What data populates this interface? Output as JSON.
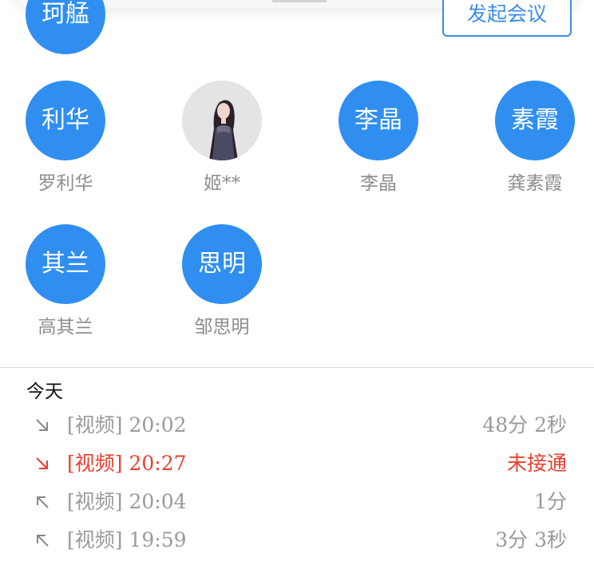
{
  "top_button": {
    "label": "发起会议"
  },
  "contacts": [
    {
      "avatar_text": "珂艋",
      "name": ""
    },
    {
      "avatar_text": "利华",
      "name": "罗利华"
    },
    {
      "avatar_text": "",
      "name": "姬**",
      "avatar_type": "photo"
    },
    {
      "avatar_text": "李晶",
      "name": "李晶"
    },
    {
      "avatar_text": "素霞",
      "name": "龚素霞"
    },
    {
      "avatar_text": "其兰",
      "name": "高其兰"
    },
    {
      "avatar_text": "思明",
      "name": "邹思明"
    }
  ],
  "colors": {
    "avatar_bg": "#2f8ef0",
    "accent": "#3b8ce8",
    "missed": "#e8402f",
    "muted_text": "#9a9a9a"
  },
  "history": {
    "section_title": "今天",
    "calls": [
      {
        "direction": "incoming",
        "icon": "incoming-arrow-icon",
        "label": "[视频] 20:02",
        "duration": "48分 2秒",
        "missed": false
      },
      {
        "direction": "incoming",
        "icon": "incoming-arrow-icon",
        "label": "[视频] 20:27",
        "duration": "未接通",
        "missed": true
      },
      {
        "direction": "outgoing",
        "icon": "outgoing-arrow-icon",
        "label": "[视频] 20:04",
        "duration": "1分",
        "missed": false
      },
      {
        "direction": "outgoing",
        "icon": "outgoing-arrow-icon",
        "label": "[视频] 19:59",
        "duration": "3分 3秒",
        "missed": false
      }
    ]
  }
}
